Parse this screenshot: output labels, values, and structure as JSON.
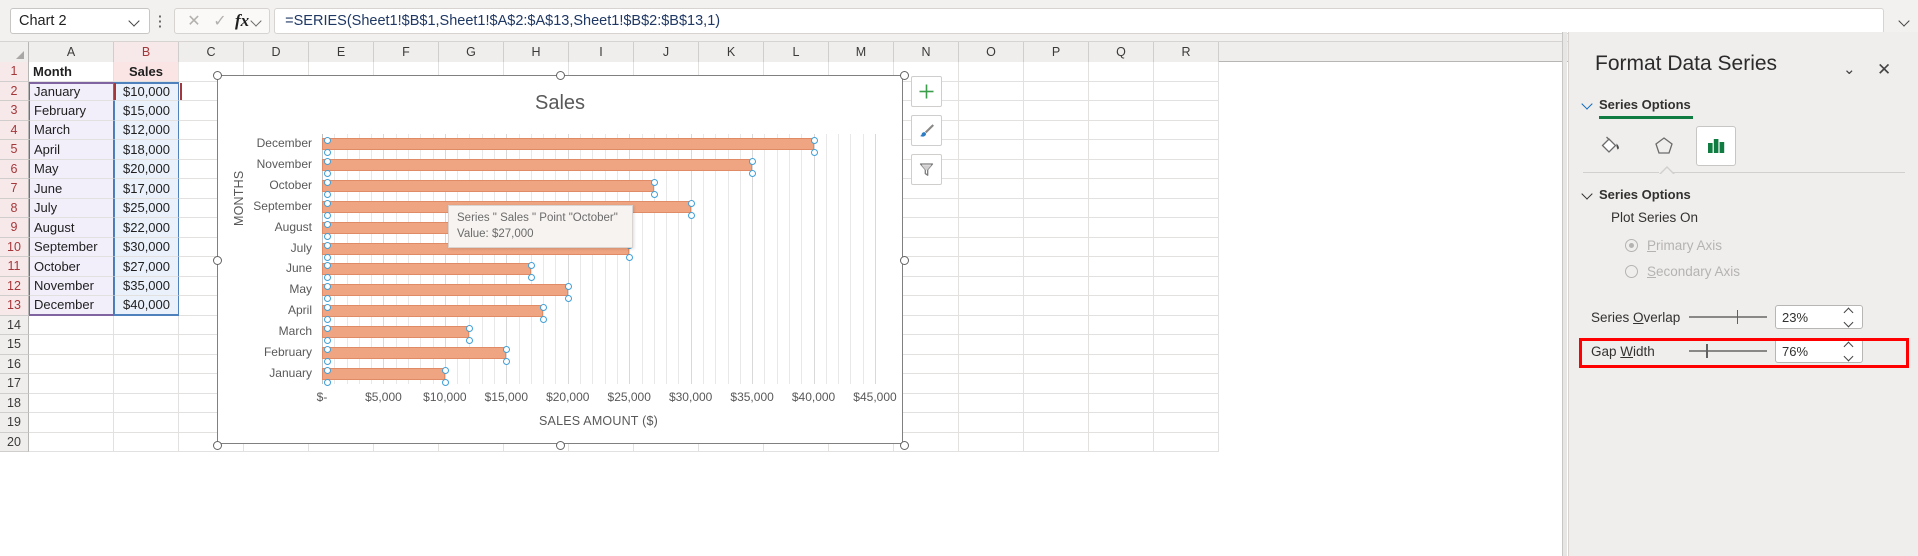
{
  "formula_bar": {
    "name_box_value": "Chart 2",
    "kebab": "⋮",
    "cancel_icon": "✕",
    "confirm_icon": "✓",
    "fx_label": "fx",
    "formula": "=SERIES(Sheet1!$B$1,Sheet1!$A$2:$A$13,Sheet1!$B$2:$B$13,1)"
  },
  "grid": {
    "columns": [
      "A",
      "B",
      "C",
      "D",
      "E",
      "F",
      "G",
      "H",
      "I",
      "J",
      "K",
      "L",
      "M",
      "N",
      "O",
      "P",
      "Q",
      "R"
    ],
    "rows": [
      "1",
      "2",
      "3",
      "4",
      "5",
      "6",
      "7",
      "8",
      "9",
      "10",
      "11",
      "12",
      "13",
      "14",
      "15",
      "16",
      "17",
      "18",
      "19",
      "20"
    ],
    "header_row": {
      "a": "Month",
      "b": "Sales"
    },
    "data": [
      {
        "row": "2",
        "month": "January",
        "sales": "$10,000"
      },
      {
        "row": "3",
        "month": "February",
        "sales": "$15,000"
      },
      {
        "row": "4",
        "month": "March",
        "sales": "$12,000"
      },
      {
        "row": "5",
        "month": "April",
        "sales": "$18,000"
      },
      {
        "row": "6",
        "month": "May",
        "sales": "$20,000"
      },
      {
        "row": "7",
        "month": "June",
        "sales": "$17,000"
      },
      {
        "row": "8",
        "month": "July",
        "sales": "$25,000"
      },
      {
        "row": "9",
        "month": "August",
        "sales": "$22,000"
      },
      {
        "row": "10",
        "month": "September",
        "sales": "$30,000"
      },
      {
        "row": "11",
        "month": "October",
        "sales": "$27,000"
      },
      {
        "row": "12",
        "month": "November",
        "sales": "$35,000"
      },
      {
        "row": "13",
        "month": "December",
        "sales": "$40,000"
      }
    ]
  },
  "chart": {
    "title": "Sales",
    "tooltip_line1": "Series \" Sales \" Point \"October\"",
    "tooltip_line2": "Value:  $27,000",
    "buttons": [
      {
        "name": "chart-elements",
        "glyph": "+"
      },
      {
        "name": "chart-styles",
        "glyph": "brush"
      },
      {
        "name": "chart-filters",
        "glyph": "funnel"
      }
    ],
    "bar_color": "#f0a582",
    "bar_border_color": "#e08b66"
  },
  "chart_data": {
    "type": "bar",
    "orientation": "horizontal",
    "title": "Sales",
    "xlabel": "SALES AMOUNT ($)",
    "ylabel": "MONTHS",
    "categories": [
      "December",
      "November",
      "October",
      "September",
      "August",
      "July",
      "June",
      "May",
      "April",
      "March",
      "February",
      "January"
    ],
    "values": [
      40000,
      35000,
      27000,
      30000,
      22000,
      25000,
      17000,
      20000,
      18000,
      12000,
      15000,
      10000
    ],
    "series": [
      {
        "name": "Sales",
        "values": [
          40000,
          35000,
          27000,
          30000,
          22000,
          25000,
          17000,
          20000,
          18000,
          12000,
          15000,
          10000
        ]
      }
    ],
    "xlim": [
      0,
      45000
    ],
    "xticks": [
      "$-",
      "$5,000",
      "$10,000",
      "$15,000",
      "$20,000",
      "$25,000",
      "$30,000",
      "$35,000",
      "$40,000",
      "$45,000"
    ],
    "xtick_values": [
      0,
      5000,
      10000,
      15000,
      20000,
      25000,
      30000,
      35000,
      40000,
      45000
    ],
    "grid": true,
    "legend": "none",
    "selected_series": "Sales",
    "highlighted_point": {
      "category": "October",
      "value": "$27,000"
    }
  },
  "task_pane": {
    "title": "Format Data Series",
    "collapse_icon": "⌄",
    "close_icon": "✕",
    "series_options_link": "Series Options",
    "tabs": [
      {
        "name": "fill-line",
        "active": false
      },
      {
        "name": "effects",
        "active": false
      },
      {
        "name": "series-options",
        "active": true
      }
    ],
    "group_title": "Series Options",
    "plot_series_on_label": "Plot Series On",
    "radios": [
      {
        "label": "Primary Axis",
        "selected": true,
        "disabled": true
      },
      {
        "label": "Secondary Axis",
        "selected": false,
        "disabled": true
      }
    ],
    "sliders": [
      {
        "label": "Series Overlap",
        "value": "23%",
        "thumb_pct": 61,
        "highlighted": false
      },
      {
        "label": "Gap Width",
        "value": "76%",
        "thumb_pct": 22,
        "highlighted": true
      }
    ],
    "highlight_color": "#ff0000"
  }
}
